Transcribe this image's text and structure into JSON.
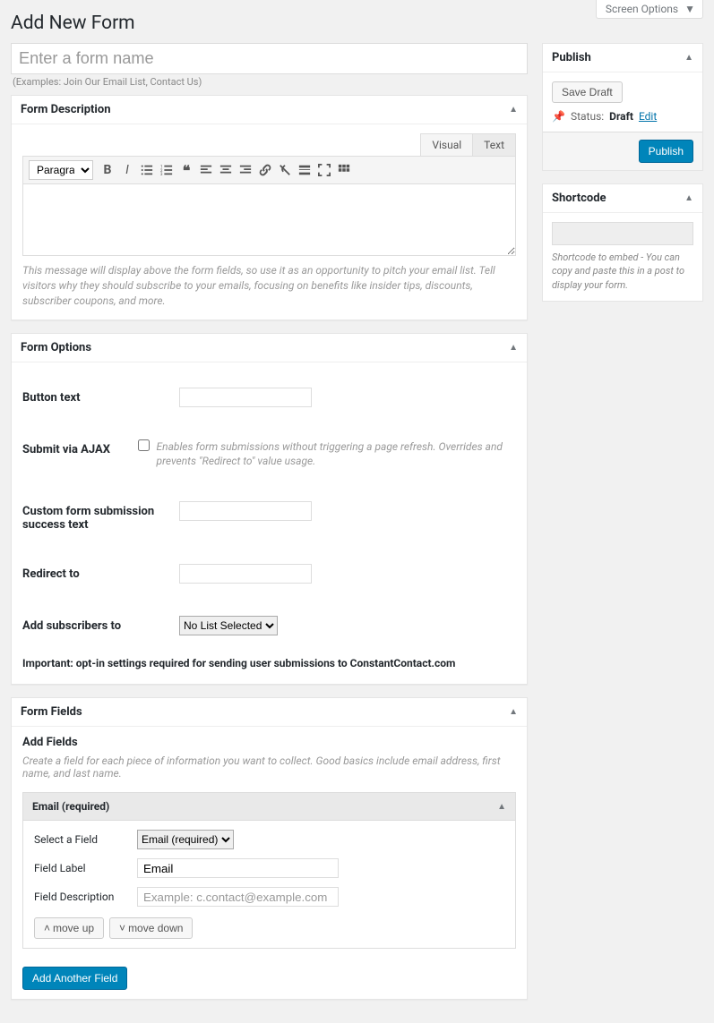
{
  "screenOptions": {
    "label": "Screen Options"
  },
  "pageTitle": "Add New Form",
  "titleBox": {
    "placeholder": "Enter a form name",
    "hint": "(Examples: Join Our Email List, Contact Us)"
  },
  "descBox": {
    "title": "Form Description",
    "tabs": {
      "visual": "Visual",
      "text": "Text"
    },
    "formatSelect": "Paragraph",
    "hint": "This message will display above the form fields, so use it as an opportunity to pitch your email list. Tell visitors why they should subscribe to your emails, focusing on benefits like insider tips, discounts, subscriber coupons, and more."
  },
  "optionsBox": {
    "title": "Form Options",
    "buttonText": {
      "label": "Button text",
      "value": ""
    },
    "ajax": {
      "label": "Submit via AJAX",
      "help": "Enables form submissions without triggering a page refresh. Overrides and prevents \"Redirect to\" value usage."
    },
    "successText": {
      "label": "Custom form submission success text",
      "value": ""
    },
    "redirect": {
      "label": "Redirect to",
      "value": ""
    },
    "addSubs": {
      "label": "Add subscribers to",
      "selected": "No List Selected"
    },
    "important": "Important: opt-in settings required for sending user submissions to ConstantContact.com"
  },
  "fieldsBox": {
    "title": "Form Fields",
    "addFields": {
      "heading": "Add Fields",
      "hint": "Create a field for each piece of information you want to collect. Good basics include email address, first name, and last name."
    },
    "card": {
      "title": "Email (required)",
      "selectField": {
        "label": "Select a Field",
        "value": "Email (required)"
      },
      "fieldLabel": {
        "label": "Field Label",
        "value": "Email"
      },
      "fieldDesc": {
        "label": "Field Description",
        "placeholder": "Example: c.contact@example.com",
        "value": ""
      },
      "moveUp": "move up",
      "moveDown": "move down"
    },
    "addAnother": "Add Another Field"
  },
  "publishBox": {
    "title": "Publish",
    "saveDraft": "Save Draft",
    "statusLabel": "Status:",
    "statusValue": "Draft",
    "editLink": "Edit",
    "publishBtn": "Publish"
  },
  "shortcodeBox": {
    "title": "Shortcode",
    "hintLead": "Shortcode to embed - ",
    "hintRest": "You can copy and paste this in a post to display your form."
  }
}
